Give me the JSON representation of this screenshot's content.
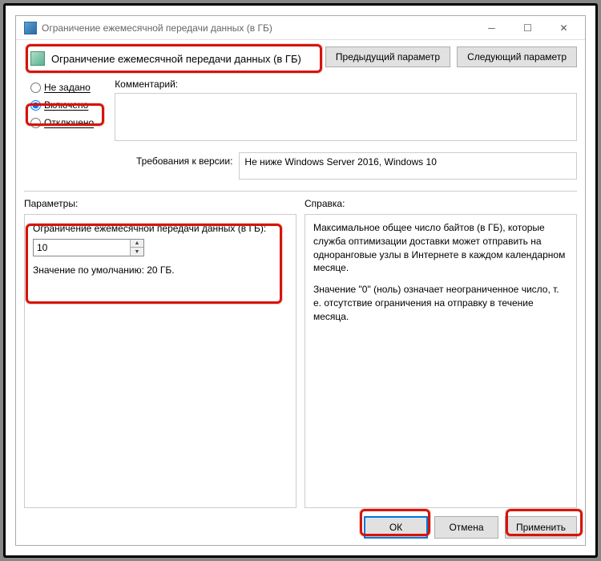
{
  "titlebar": {
    "title": "Ограничение ежемесячной передачи данных (в ГБ)"
  },
  "header": {
    "title": "Ограничение ежемесячной передачи данных (в ГБ)",
    "prev": "Предыдущий параметр",
    "next": "Следующий параметр"
  },
  "radio": {
    "not_configured": "Не задано",
    "enabled": "Включено",
    "disabled": "Отключено",
    "selected": "enabled"
  },
  "comment": {
    "label": "Комментарий:",
    "value": ""
  },
  "version": {
    "label": "Требования к версии:",
    "text": "Не ниже Windows Server 2016, Windows 10"
  },
  "params": {
    "header": "Параметры:",
    "label": "Ограничение ежемесячной передачи данных (в ГБ):",
    "value": "10",
    "default": "Значение по умолчанию: 20 ГБ."
  },
  "help": {
    "header": "Справка:",
    "p1": "Максимальное общее число байтов (в ГБ), которые служба оптимизации доставки может отправить на одноранговые узлы в Интернете в каждом календарном месяце.",
    "p2": "Значение \"0\" (ноль) означает неограниченное число, т. е. отсутствие ограничения на отправку в течение месяца."
  },
  "buttons": {
    "ok": "ОК",
    "cancel": "Отмена",
    "apply": "Применить"
  }
}
